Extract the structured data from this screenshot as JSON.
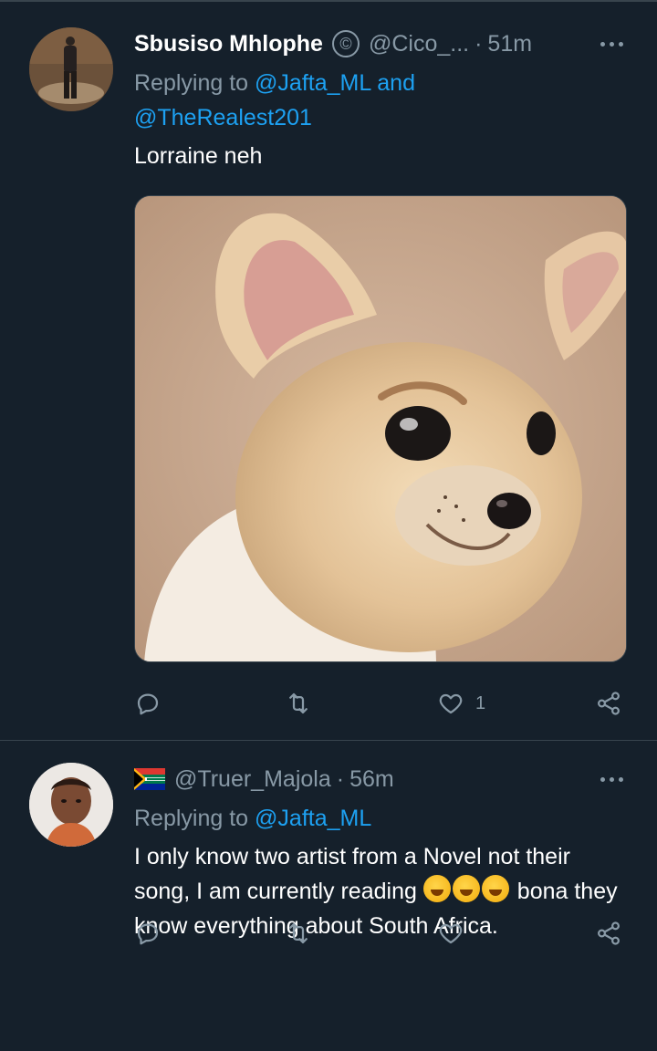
{
  "tweets": [
    {
      "display_name": "Sbusiso Mhlophe",
      "handle": "@Cico_...",
      "time": "51m",
      "replying_prefix": "Replying to",
      "replying_mention_1": "@Jafta_ML",
      "replying_and": "and",
      "replying_mention_2": "@TheRealest201",
      "text": "Lorraine neh",
      "like_count": "1"
    },
    {
      "handle": "@Truer_Majola",
      "time": "56m",
      "replying_prefix": "Replying to",
      "replying_mention_1": "@Jafta_ML",
      "text_part1": "I only know two artist from a Novel not their song, I am currently reading",
      "text_part2": "bona they know everything about South Africa."
    }
  ],
  "icons": {
    "verified_badge": "copyright-circle-icon",
    "reply": "reply-icon",
    "retweet": "retweet-icon",
    "like": "heart-icon",
    "share": "share-icon",
    "more": "more-dots-icon",
    "flag": "south-africa-flag-icon",
    "emoji": "rofl-emoji-icon"
  },
  "colors": {
    "background": "#15202b",
    "text": "#ffffff",
    "muted": "#8899a6",
    "link": "#1da1f2",
    "divider": "#38444d"
  }
}
